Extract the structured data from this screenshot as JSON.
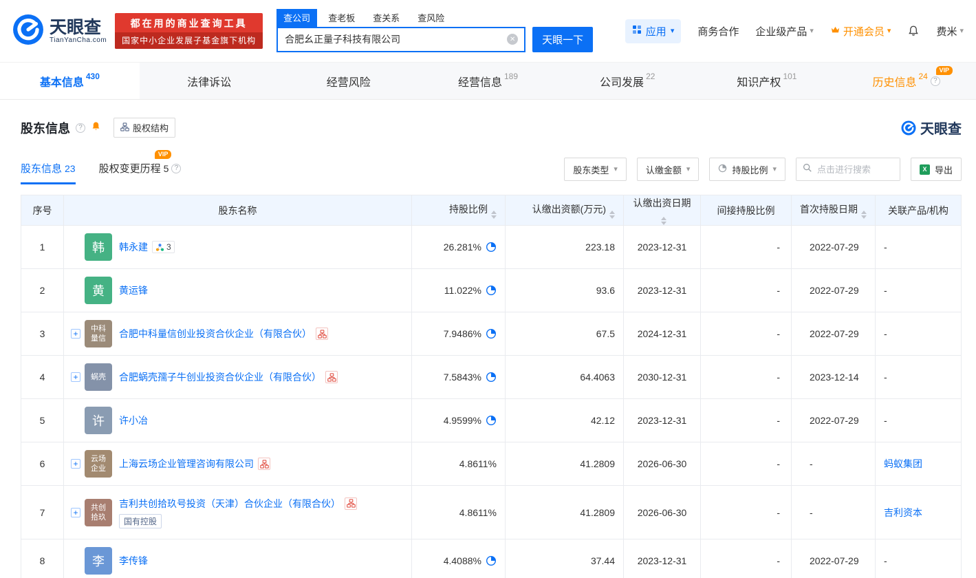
{
  "brand": {
    "name": "天眼查",
    "domain": "TianYanCha.com",
    "promo_line1": "都在用的商业查询工具",
    "promo_line2": "国家中小企业发展子基金旗下机构"
  },
  "search": {
    "tabs": [
      {
        "label": "查公司"
      },
      {
        "label": "查老板"
      },
      {
        "label": "查关系"
      },
      {
        "label": "查风险"
      }
    ],
    "value": "合肥幺正量子科技有限公司",
    "button": "天眼一下"
  },
  "top_menu": {
    "apps": "应用",
    "business": "商务合作",
    "enterprise": "企业级产品",
    "vip": "开通会员",
    "user": "费米"
  },
  "nav_tabs": [
    {
      "label": "基本信息",
      "count": "430"
    },
    {
      "label": "法律诉讼",
      "count": ""
    },
    {
      "label": "经营风险",
      "count": ""
    },
    {
      "label": "经营信息",
      "count": "189"
    },
    {
      "label": "公司发展",
      "count": "22"
    },
    {
      "label": "知识产权",
      "count": "101"
    },
    {
      "label": "历史信息",
      "count": "24",
      "vip": "VIP"
    }
  ],
  "section": {
    "title": "股东信息",
    "equity_structure": "股权结构",
    "brand_mark": "天眼查",
    "tab_main": "股东信息",
    "tab_main_count": "23",
    "tab_history": "股权变更历程",
    "tab_history_count": "5",
    "vip_badge": "VIP",
    "filter_type": "股东类型",
    "filter_amount": "认缴金额",
    "filter_ratio": "持股比例",
    "search_placeholder": "点击进行搜索",
    "export": "导出"
  },
  "table": {
    "columns": {
      "no": "序号",
      "name": "股东名称",
      "ratio": "持股比例",
      "amount": "认缴出资额(万元)",
      "date": "认缴出资日期",
      "indirect": "间接持股比例",
      "first": "首次持股日期",
      "related": "关联产品/机构"
    },
    "rows": [
      {
        "no": "1",
        "avatar": "韩",
        "color": "#45b284",
        "name": "韩永建",
        "graph_count": "3",
        "ratio": "26.281%",
        "amount": "223.18",
        "date": "2023-12-31",
        "indirect": "-",
        "first": "2022-07-29",
        "related": "-"
      },
      {
        "no": "2",
        "avatar": "黄",
        "color": "#45b284",
        "name": "黄运锋",
        "ratio": "11.022%",
        "amount": "93.6",
        "date": "2023-12-31",
        "indirect": "-",
        "first": "2022-07-29",
        "related": "-"
      },
      {
        "no": "3",
        "avatar": "中科\n量信",
        "color": "#9b8b79",
        "name": "合肥中科量信创业投资合伙企业（有限合伙）",
        "ratio": "7.9486%",
        "amount": "67.5",
        "date": "2024-12-31",
        "indirect": "-",
        "first": "2022-07-29",
        "related": "-"
      },
      {
        "no": "4",
        "avatar": "蜗壳",
        "color": "#8492a9",
        "name": "合肥蜗壳孺子牛创业投资合伙企业（有限合伙）",
        "ratio": "7.5843%",
        "amount": "64.4063",
        "date": "2030-12-31",
        "indirect": "-",
        "first": "2023-12-14",
        "related": "-"
      },
      {
        "no": "5",
        "avatar": "许",
        "color": "#8a9cb2",
        "name": "许小冶",
        "ratio": "4.9599%",
        "amount": "42.12",
        "date": "2023-12-31",
        "indirect": "-",
        "first": "2022-07-29",
        "related": "-"
      },
      {
        "no": "6",
        "avatar": "云场\n企业",
        "color": "#a28a70",
        "name": "上海云场企业管理咨询有限公司",
        "ratio": "4.8611%",
        "amount": "41.2809",
        "date": "2026-06-30",
        "indirect": "-",
        "first": "-",
        "related": "蚂蚁集团"
      },
      {
        "no": "7",
        "avatar": "共创\n拾玖",
        "color": "#a87e70",
        "name": "吉利共创拾玖号投资（天津）合伙企业（有限合伙）",
        "tag": "国有控股",
        "ratio": "4.8611%",
        "amount": "41.2809",
        "date": "2026-06-30",
        "indirect": "-",
        "first": "-",
        "related": "吉利资本"
      },
      {
        "no": "8",
        "avatar": "李",
        "color": "#6a97d6",
        "name": "李传锋",
        "ratio": "4.4088%",
        "amount": "37.44",
        "date": "2023-12-31",
        "indirect": "-",
        "first": "2022-07-29",
        "related": "-"
      }
    ]
  },
  "colors": {
    "primary": "#0b70f5",
    "vip_orange": "#ff9000",
    "promo_red": "#e0392e"
  }
}
